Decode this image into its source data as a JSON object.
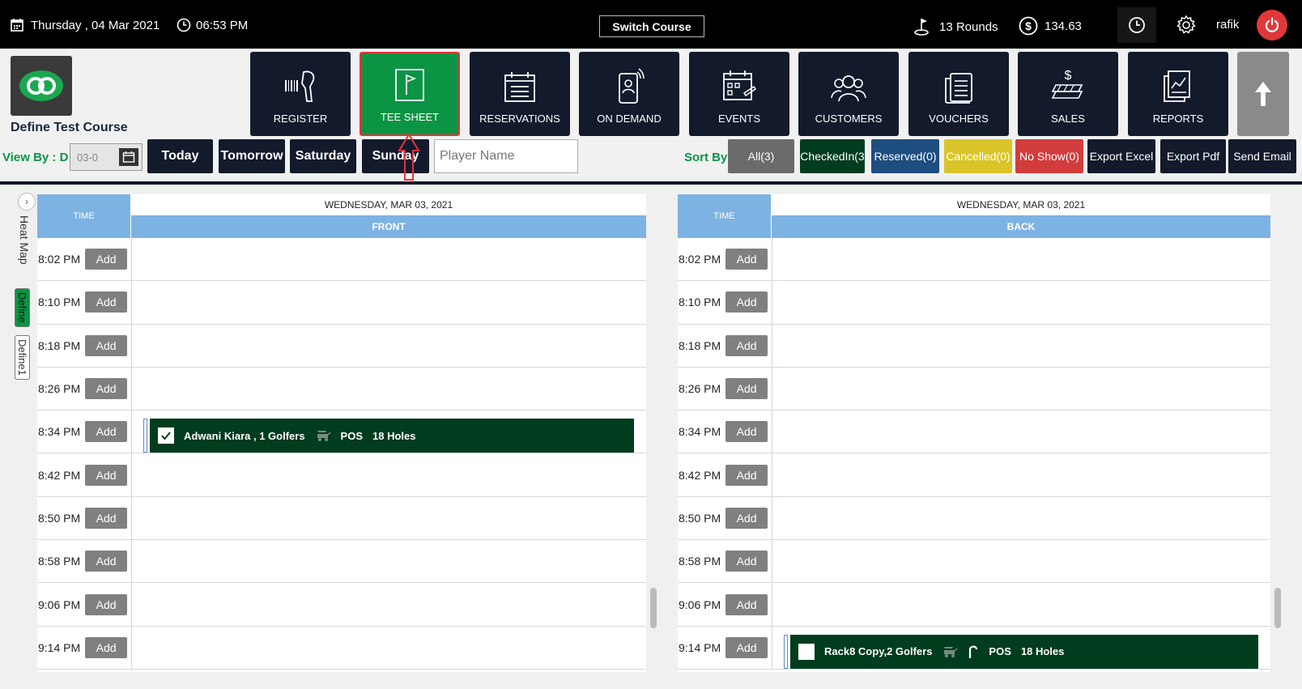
{
  "topbar": {
    "date": "Thursday , 04 Mar 2021",
    "time": "06:53 PM",
    "switch_course": "Switch Course",
    "rounds": "13 Rounds",
    "amount": "134.63",
    "user": "rafik"
  },
  "header": {
    "course_name": "Define Test Course",
    "nav": [
      {
        "label": "REGISTER",
        "icon": "barcode-scanner-icon"
      },
      {
        "label": "TEE SHEET",
        "icon": "flag-icon",
        "active": true
      },
      {
        "label": "RESERVATIONS",
        "icon": "calendar-list-icon"
      },
      {
        "label": "ON DEMAND",
        "icon": "mobile-user-icon"
      },
      {
        "label": "EVENTS",
        "icon": "calendar-events-icon"
      },
      {
        "label": "CUSTOMERS",
        "icon": "users-icon"
      },
      {
        "label": "VOUCHERS",
        "icon": "voucher-icon"
      },
      {
        "label": "SALES",
        "icon": "money-stack-icon"
      },
      {
        "label": "REPORTS",
        "icon": "report-chart-icon"
      }
    ]
  },
  "filters": {
    "view_by": "View By : D",
    "date_value": "03-0",
    "days": [
      "Today",
      "Tomorrow",
      "Saturday",
      "Sunday"
    ],
    "player_placeholder": "Player Name",
    "sort_by": "Sort By",
    "all": "All(3)",
    "checked_in": "CheckedIn(3",
    "reserved": "Reserved(0)",
    "cancelled": "Cancelled(0)",
    "no_show": "No Show(0)",
    "export_excel": "Export Excel",
    "export_pdf": "Export Pdf",
    "send_email": "Send Email",
    "colors": {
      "all": "#6b6b6b",
      "checked_in": "#003c1e",
      "reserved": "#1e4d80",
      "cancelled": "#d9c42a",
      "no_show": "#d23c3c",
      "dark": "#121a2c"
    }
  },
  "side": {
    "heat_map": "Heat Map",
    "tabs": [
      "Define",
      "Define1"
    ]
  },
  "sheet": {
    "time_header": "TIME",
    "add_label": "Add",
    "times": [
      "8:02 PM",
      "8:10 PM",
      "8:18 PM",
      "8:26 PM",
      "8:34 PM",
      "8:42 PM",
      "8:50 PM",
      "8:58 PM",
      "9:06 PM",
      "9:14 PM"
    ],
    "front": {
      "date": "WEDNESDAY, MAR 03, 2021",
      "section": "FRONT",
      "booking": {
        "row": 4,
        "name": "Adwani Kiara , 1 Golfers",
        "pos": "POS",
        "holes": "18 Holes",
        "checked": true
      }
    },
    "back": {
      "date": "WEDNESDAY, MAR 03, 2021",
      "section": "BACK",
      "booking": {
        "row": 9,
        "name": "Rack8 Copy,2 Golfers",
        "pos": "POS",
        "holes": "18 Holes",
        "checked": false
      }
    }
  }
}
